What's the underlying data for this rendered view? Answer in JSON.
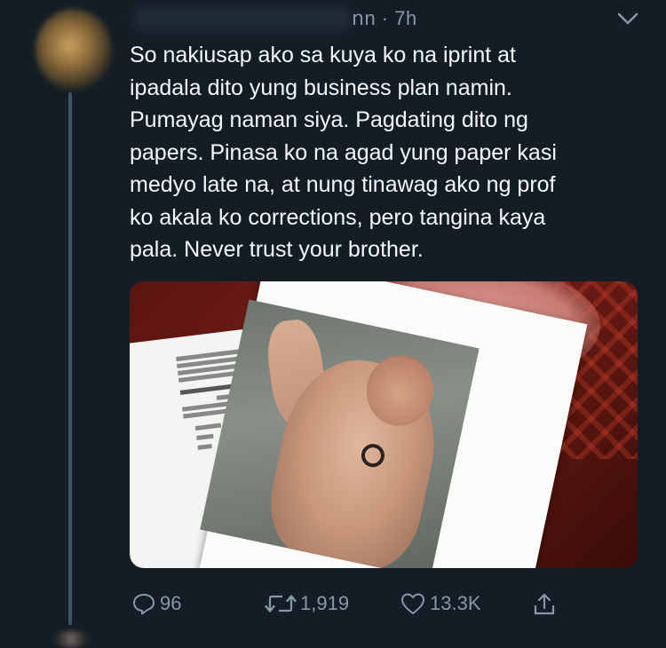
{
  "tweet": {
    "meta": "ոn · 7h",
    "text": "So nakiusap ako sa kuya ko na iprint at\nipadala dito yung business plan namin.\nPumayag naman siya. Pagdating dito ng\npapers. Pinasa ko na agad yung paper kasi\nmedyo late na, at nung tinawag ako ng prof\nko akala ko corrections, pero tangina kaya\npala. Never trust your brother."
  },
  "actions": {
    "replies": "96",
    "retweets": "1,919",
    "likes": "13.3K"
  },
  "icons": {
    "menu": "chevron-down-icon",
    "reply": "reply-icon",
    "retweet": "retweet-icon",
    "like": "heart-icon",
    "share": "share-icon"
  },
  "colors": {
    "background": "#141d26",
    "secondary_text": "#8899a6",
    "primary_text": "#f5f8fa"
  }
}
